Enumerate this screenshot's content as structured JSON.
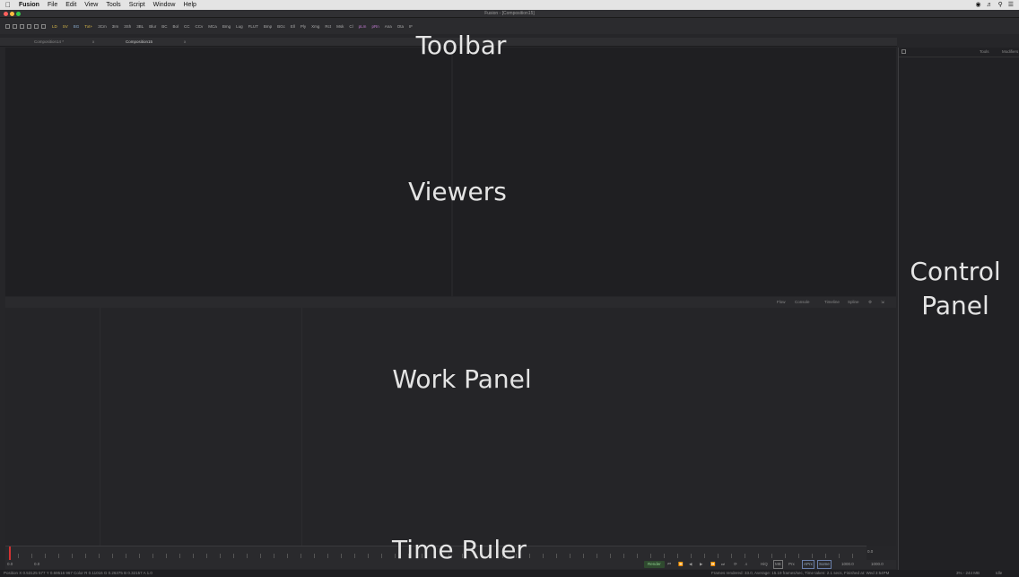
{
  "menubar": {
    "app": "Fusion",
    "items": [
      "File",
      "Edit",
      "View",
      "Tools",
      "Script",
      "Window",
      "Help"
    ]
  },
  "window": {
    "title": "Fusion - [Composition15]"
  },
  "toolbar_buttons": [
    "LD",
    "SV",
    "BG",
    "Txt+",
    "3Cm",
    "3Im",
    "3Sh",
    "3BL",
    "Blur",
    "BC",
    "Bol",
    "CC",
    "CCv",
    "MCa",
    "Bmg",
    "Lug",
    "FLUT",
    "Bmp",
    "BGc",
    "Ell",
    "Ply",
    "Xmg",
    "Rct",
    "Msk",
    "Cl",
    "pLm",
    "pRn",
    "Ana",
    "Ota",
    "IF"
  ],
  "comp_tabs": [
    {
      "label": "Composition14 *",
      "close": "x"
    },
    {
      "label": "Composition15",
      "close": "x"
    }
  ],
  "control_panel_tabs": {
    "tools": "Tools",
    "modifiers": "Modifiers"
  },
  "work_tabs": [
    "Flow",
    "Console",
    "Timeline",
    "Spline"
  ],
  "ruler": {
    "start": "0.0",
    "end_value": "0.0",
    "current": "0.0"
  },
  "transport": {
    "start": "0.0",
    "current": "0.0",
    "render": "Render",
    "hiq": "HiQ",
    "mb": "MB",
    "prx": "Prx",
    "aprx": "APrx",
    "some": "Some",
    "end_a": "1000.0",
    "end_b": "1000.0"
  },
  "statusbar": {
    "left": "Position X 0.53125   577   Y 0.69516   967   Color R 0.11016   G 0.26375   B 0.32157   A 1.0",
    "right": "Frames rendered: 33.0,  Average: 15.19 frames/sec,  Time taken: 2.1 secs,  Finished at: Wed 3:54PM",
    "mem": "3% - 244 MB",
    "idle": "Idle"
  },
  "overlays": {
    "toolbar": "Toolbar",
    "viewers": "Viewers",
    "control_panel_line1": "Control",
    "control_panel_line2": "Panel",
    "work_panel": "Work Panel",
    "time_ruler": "Time Ruler"
  },
  "colors": {
    "close": "#fc605c",
    "minimize": "#fdbc40",
    "zoom": "#34c84a",
    "playhead": "#d23232"
  }
}
